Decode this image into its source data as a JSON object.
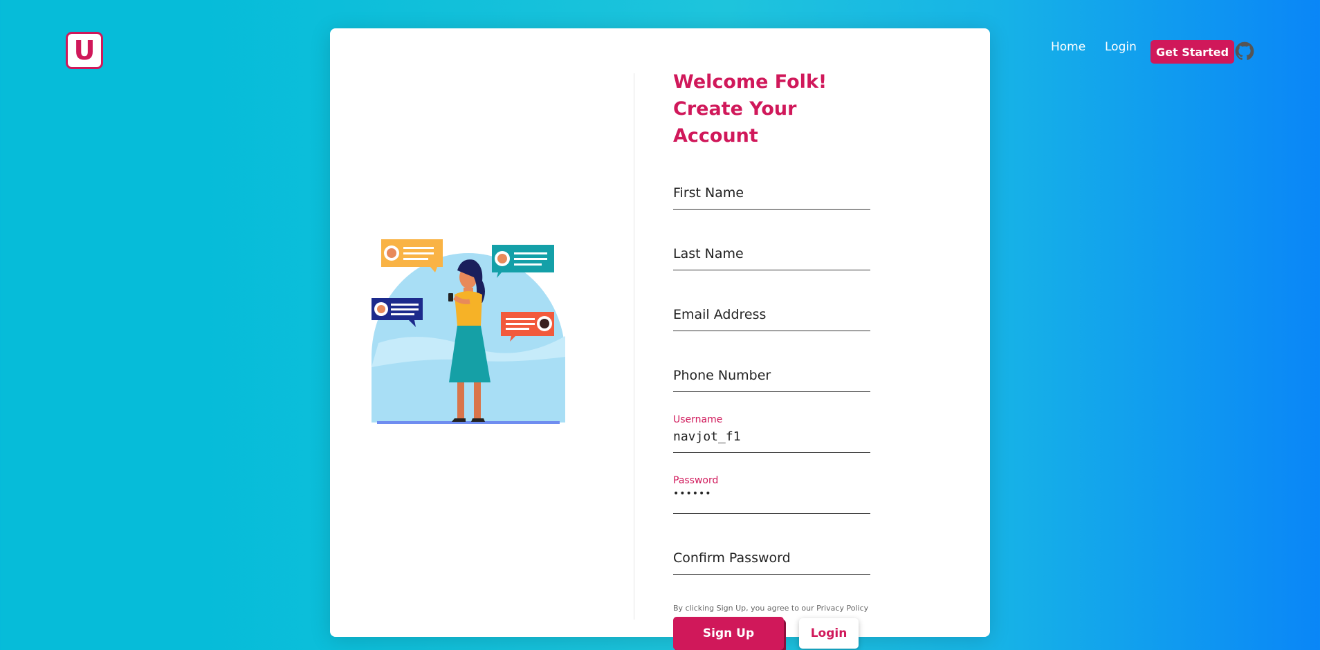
{
  "brand": {
    "logo_letter": "U"
  },
  "nav": {
    "home": "Home",
    "login": "Login",
    "get_started": "Get Started",
    "github_icon": "github-icon"
  },
  "illustration": {
    "icon": "woman-chatting-illustration"
  },
  "form": {
    "title_line1": "Welcome Folk!",
    "title_line2": "Create Your Account",
    "fields": {
      "first_name": {
        "placeholder": "First Name"
      },
      "last_name": {
        "placeholder": "Last Name"
      },
      "email": {
        "placeholder": "Email Address"
      },
      "phone": {
        "placeholder": "Phone Number"
      },
      "username": {
        "label": "Username",
        "value": "navjot_f1"
      },
      "password": {
        "label": "Password",
        "value": "••••••"
      },
      "confirm": {
        "placeholder": "Confirm Password"
      }
    },
    "terms": "By clicking Sign Up, you agree to our Privacy Policy",
    "signup_label": "Sign Up",
    "login_label": "Login"
  },
  "colors": {
    "accent": "#d0185a",
    "bg_left": "#06bcd9",
    "bg_right": "#0a86f7"
  }
}
